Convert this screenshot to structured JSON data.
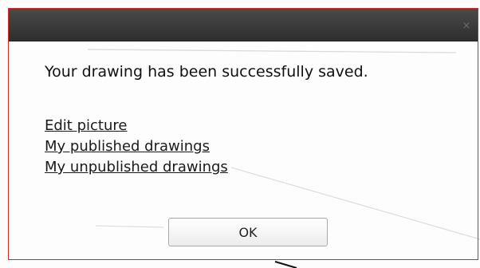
{
  "dialog": {
    "close_glyph": "×",
    "close_icon": "close-icon",
    "message": "Your drawing has been successfully saved.",
    "links": {
      "edit_picture": "Edit picture",
      "my_published": "My published drawings",
      "my_unpublished": "My unpublished drawings"
    },
    "ok_label": "OK"
  },
  "colors": {
    "titlebar": "#3a3a3a",
    "border": "#d22a2a"
  }
}
